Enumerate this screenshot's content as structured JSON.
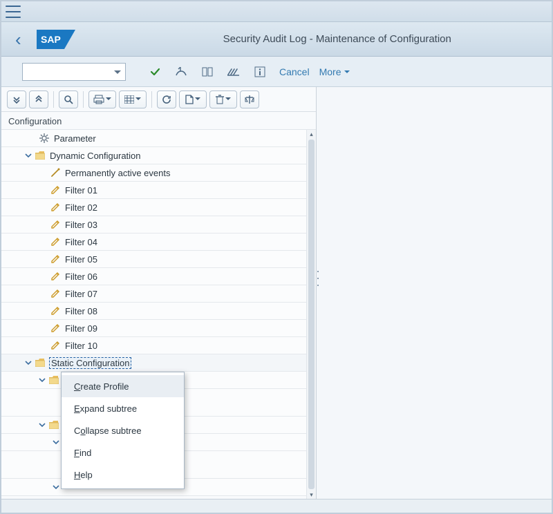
{
  "header": {
    "page_title": "Security Audit Log - Maintenance of Configuration"
  },
  "toolbar": {
    "cancel_label": "Cancel",
    "more_label": "More"
  },
  "tree": {
    "header": "Configuration",
    "parameter_label": "Parameter",
    "dynamic_label": "Dynamic Configuration",
    "perm_active_label": "Permanently active events",
    "filters": [
      "Filter 01",
      "Filter 02",
      "Filter 03",
      "Filter 04",
      "Filter 05",
      "Filter 06",
      "Filter 07",
      "Filter 08",
      "Filter 09",
      "Filter 10"
    ],
    "static_label": "Static Configuration"
  },
  "context_menu": {
    "create_profile": "Create Profile",
    "expand": "Expand subtree",
    "collapse": "Collapse subtree",
    "find": "Find",
    "help": "Help"
  }
}
